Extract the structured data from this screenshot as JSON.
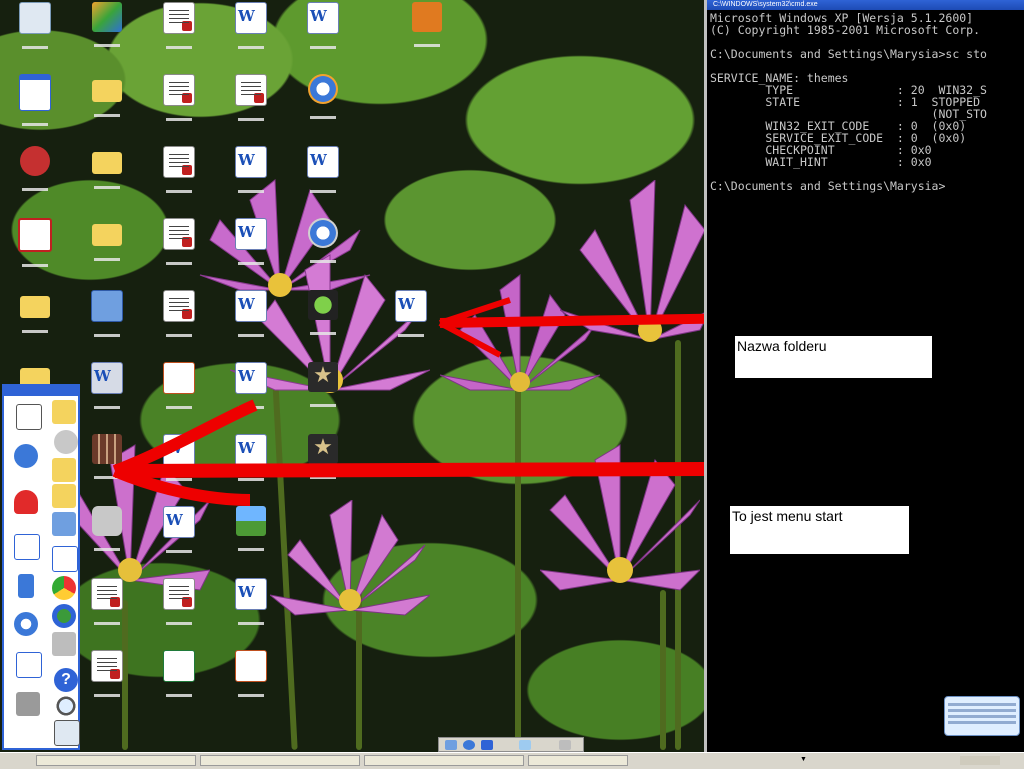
{
  "console": {
    "title": "C:\\WINDOWS\\system32\\cmd.exe",
    "lines": [
      "Microsoft Windows XP [Wersja 5.1.2600]",
      "(C) Copyright 1985-2001 Microsoft Corp.",
      "",
      "C:\\Documents and Settings\\Marysia>sc sto",
      "",
      "SERVICE_NAME: themes",
      "        TYPE               : 20  WIN32_S",
      "        STATE              : 1  STOPPED",
      "                                (NOT_STO",
      "        WIN32_EXIT_CODE    : 0  (0x0)",
      "        SERVICE_EXIT_CODE  : 0  (0x0)",
      "        CHECKPOINT         : 0x0",
      "        WAIT_HINT          : 0x0",
      "",
      "C:\\Documents and Settings\\Marysia>"
    ]
  },
  "annotations": {
    "folder_name": "Nazwa folderu",
    "start_menu": "To jest menu start"
  },
  "colors": {
    "arrow": "#ee0000",
    "console_bg": "#000000",
    "console_text": "#c8c8c8",
    "title_blue": "#2f63d6"
  },
  "desktop_icons": [
    {
      "icon": "recycle-bin-icon"
    },
    {
      "icon": "msn-butterfly-icon"
    },
    {
      "icon": "pdf-document-icon"
    },
    {
      "icon": "word-document-icon"
    },
    {
      "icon": "word-document-icon"
    },
    {
      "icon": "application-icon"
    },
    {
      "icon": "window-shortcut-icon"
    },
    {
      "icon": "folder-icon"
    },
    {
      "icon": "pdf-document-icon"
    },
    {
      "icon": "pdf-document-icon"
    },
    {
      "icon": "media-player-icon"
    },
    {
      "icon": "game-shortcut-icon"
    },
    {
      "icon": "folder-icon"
    },
    {
      "icon": "pdf-document-icon"
    },
    {
      "icon": "word-document-icon"
    },
    {
      "icon": "word-document-icon"
    },
    {
      "icon": "adobe-reader-icon"
    },
    {
      "icon": "folder-icon"
    },
    {
      "icon": "pdf-document-icon"
    },
    {
      "icon": "word-document-icon"
    },
    {
      "icon": "media-player-icon"
    },
    {
      "icon": "folder-icon"
    },
    {
      "icon": "my-computer-icon"
    },
    {
      "icon": "pdf-document-icon"
    },
    {
      "icon": "word-document-icon"
    },
    {
      "icon": "green-app-icon"
    },
    {
      "icon": "word-document-icon"
    },
    {
      "icon": "folder-icon"
    },
    {
      "icon": "word-document-icon"
    },
    {
      "icon": "powerpoint-icon"
    },
    {
      "icon": "word-document-icon"
    },
    {
      "icon": "star-game-icon"
    },
    {
      "icon": "calendar-shortcut-icon"
    },
    {
      "icon": "word-document-icon"
    },
    {
      "icon": "word-document-icon"
    },
    {
      "icon": "star-game-icon"
    },
    {
      "icon": "camera-shortcut-icon"
    },
    {
      "icon": "word-document-icon"
    },
    {
      "icon": "picture-icon"
    },
    {
      "icon": "pdf-document-icon"
    },
    {
      "icon": "pdf-document-icon"
    },
    {
      "icon": "word-document-icon"
    },
    {
      "icon": "pdf-document-icon"
    },
    {
      "icon": "excel-icon"
    },
    {
      "icon": "powerpoint-icon"
    }
  ],
  "start_panel": {
    "icons": [
      "notepad-window-icon",
      "folder-open-icon",
      "refresh-icon",
      "clock-icon",
      "folder-icon",
      "heart-icon",
      "folder-icon",
      "network-icon",
      "word-icon",
      "checklist-icon",
      "usb-icon",
      "chrome-icon",
      "media-player-icon",
      "globe-icon",
      "pen-icon",
      "printer-icon",
      "scanner-icon",
      "help-icon",
      "search-icon",
      "run-icon"
    ]
  },
  "taskbar": {
    "buttons": [
      "",
      "",
      "",
      ""
    ]
  }
}
